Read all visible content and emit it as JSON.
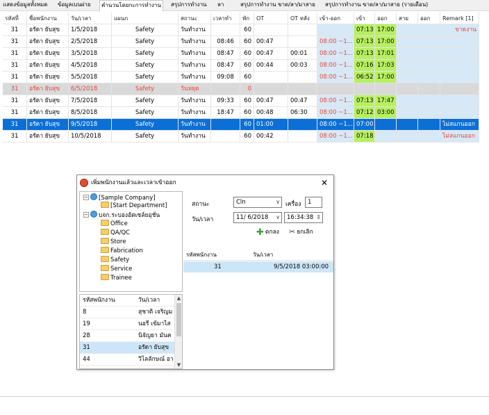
{
  "tabs": [
    {
      "label": "แสดงข้อมูลทั้งหมด",
      "active": false
    },
    {
      "label": "ข้อมูลเบนผ่าย",
      "active": false
    },
    {
      "label": "คำนวนโดยกะการทำงาน",
      "active": true
    },
    {
      "label": "สรุปการทำงาน",
      "active": false
    },
    {
      "label": "ลา",
      "active": false
    },
    {
      "label": "สรุปการทำงาน ขาด/ลา/มาสาย",
      "active": false
    },
    {
      "label": "สรุปการทำงาน ขาด/ลา/มาสาย (รายเดือน)",
      "active": false
    }
  ],
  "grid": {
    "columns": [
      "รหัสที่",
      "ชื่อพนักงาน",
      "วัน/เวลา",
      "แผนก",
      "สถานะ",
      "เวลาทำ",
      "พัก",
      "OT",
      "OT หลัง",
      "เข้า-ออก",
      "เข้า",
      "ออก",
      "สาย",
      "ออก",
      "Remark [1]"
    ],
    "rows": [
      {
        "id": "31",
        "name": "อรัดา ยับสุข",
        "date": "1/5/2018",
        "dept": "Safety",
        "status": "วันทำงาน",
        "work": "",
        "rest": "60",
        "ot": "",
        "ot_after": "",
        "inout": "",
        "in": "07:13",
        "out": "17:00",
        "late": "",
        "early": "",
        "remark": "ขาดงาน"
      },
      {
        "id": "31",
        "name": "อรัดา ยับสุข",
        "date": "2/5/2018",
        "dept": "Safety",
        "status": "วันทำงาน",
        "work": "08:46",
        "rest": "60",
        "ot": "00:47",
        "ot_after": "",
        "inout": "08:00 ~1...",
        "in": "07:13",
        "out": "17:00",
        "late": "",
        "early": "",
        "remark": ""
      },
      {
        "id": "31",
        "name": "อรัดา ยับสุข",
        "date": "3/5/2018",
        "dept": "Safety",
        "status": "วันทำงาน",
        "work": "08:47",
        "rest": "60",
        "ot": "00:47",
        "ot_after": "00:01",
        "inout": "08:00 ~1...",
        "in": "07:13",
        "out": "17:01",
        "late": "",
        "early": "",
        "remark": ""
      },
      {
        "id": "31",
        "name": "อรัดา ยับสุข",
        "date": "4/5/2018",
        "dept": "Safety",
        "status": "วันทำงาน",
        "work": "08:47",
        "rest": "60",
        "ot": "00:44",
        "ot_after": "00:03",
        "inout": "08:00 ~1...",
        "in": "07:16",
        "out": "17:03",
        "late": "",
        "early": "",
        "remark": ""
      },
      {
        "id": "31",
        "name": "อรัดา ยับสุข",
        "date": "5/5/2018",
        "dept": "Safety",
        "status": "วันทำงาน",
        "work": "09:08",
        "rest": "60",
        "ot": "",
        "ot_after": "",
        "inout": "08:00 ~1...",
        "in": "06:52",
        "out": "17:00",
        "late": "",
        "early": "",
        "remark": ""
      },
      {
        "id": "31",
        "name": "อรัดา ยับสุข",
        "date": "6/5/2018",
        "dept": "Safety",
        "status": "วันหยุด",
        "work": "",
        "rest": "0",
        "ot": "",
        "ot_after": "",
        "inout": "",
        "in": "",
        "out": "",
        "late": "",
        "early": "",
        "remark": ""
      },
      {
        "id": "31",
        "name": "อรัดา ยับสุข",
        "date": "7/5/2018",
        "dept": "Safety",
        "status": "วันทำงาน",
        "work": "09:33",
        "rest": "60",
        "ot": "00:47",
        "ot_after": "00:47",
        "inout": "08:00 ~1...",
        "in": "07:13",
        "out": "17:47",
        "late": "",
        "early": "",
        "remark": ""
      },
      {
        "id": "31",
        "name": "อรัดา ยับสุข",
        "date": "8/5/2018",
        "dept": "Safety",
        "status": "วันทำงาน",
        "work": "18:47",
        "rest": "60",
        "ot": "00:48",
        "ot_after": "06:30",
        "inout": "08:00 ~1...",
        "in": "07:12",
        "out": "03:00",
        "late": "",
        "early": "",
        "remark": ""
      },
      {
        "id": "31",
        "name": "อรัดา ยับสุข",
        "date": "9/5/2018",
        "dept": "Safety",
        "status": "วันทำงาน",
        "work": "",
        "rest": "60",
        "ot": "01:00",
        "ot_after": "",
        "inout": "08:00 ~1...",
        "in": "07:00",
        "out": "",
        "late": "",
        "early": "",
        "remark": "ไม่สแกนออก"
      },
      {
        "id": "31",
        "name": "อรัดา ยับสุข",
        "date": "10/5/2018",
        "dept": "Safety",
        "status": "วันทำงาน",
        "work": "",
        "rest": "60",
        "ot": "00:42",
        "ot_after": "",
        "inout": "08:00 ~1...",
        "in": "07:18",
        "out": "",
        "late": "",
        "early": "",
        "remark": "ไม่สแกนออก"
      }
    ]
  },
  "dialog": {
    "title": "เพิ่มพนักงานแล้วและเวลาเข้าออก",
    "close": "✕",
    "tree": {
      "company": "[Sample Company]",
      "start_dept": "[Start Department]",
      "group": "บจก.ระบองอัตเซล์ยอุชั่น",
      "departments": [
        "Office",
        "QA/QC",
        "Store",
        "Fabrication",
        "Safety",
        "Service",
        "Trainee"
      ]
    },
    "employee_list": {
      "col_id": "รหัสพนักงาน",
      "col_date": "วัน/เวลา",
      "rows": [
        {
          "id": "8",
          "name": "สุชาติ เจริญม"
        },
        {
          "id": "19",
          "name": "นอรี เข้มาไส"
        },
        {
          "id": "28",
          "name": "นิจัญยา มันค"
        },
        {
          "id": "31",
          "name": "อรัดา ยับสุข"
        },
        {
          "id": "44",
          "name": "วิไลลักษณ์ อา"
        }
      ]
    },
    "form": {
      "status_label": "สถานะ",
      "status_value": "Cln",
      "machine_label": "เครื่อง",
      "machine_value": "1",
      "datetime_label": "วัน/เวลา",
      "date_value": "11/ 6/2018",
      "time_value": "16:34:38",
      "add_label": "ตกลง",
      "cancel_label": "ยกเลิก"
    },
    "result": {
      "col_id": "รหัสพนักงาน",
      "col_date": "วัน/เวลา",
      "rows": [
        {
          "id": "31",
          "datetime": "9/5/2018 03:00:00"
        }
      ]
    }
  },
  "colors": {
    "selected_row": "#0b6fd6",
    "shade": "#d7e9f7",
    "green": "#b6f060",
    "holiday": "#d9d9d9",
    "red_text": "#e8463a"
  }
}
